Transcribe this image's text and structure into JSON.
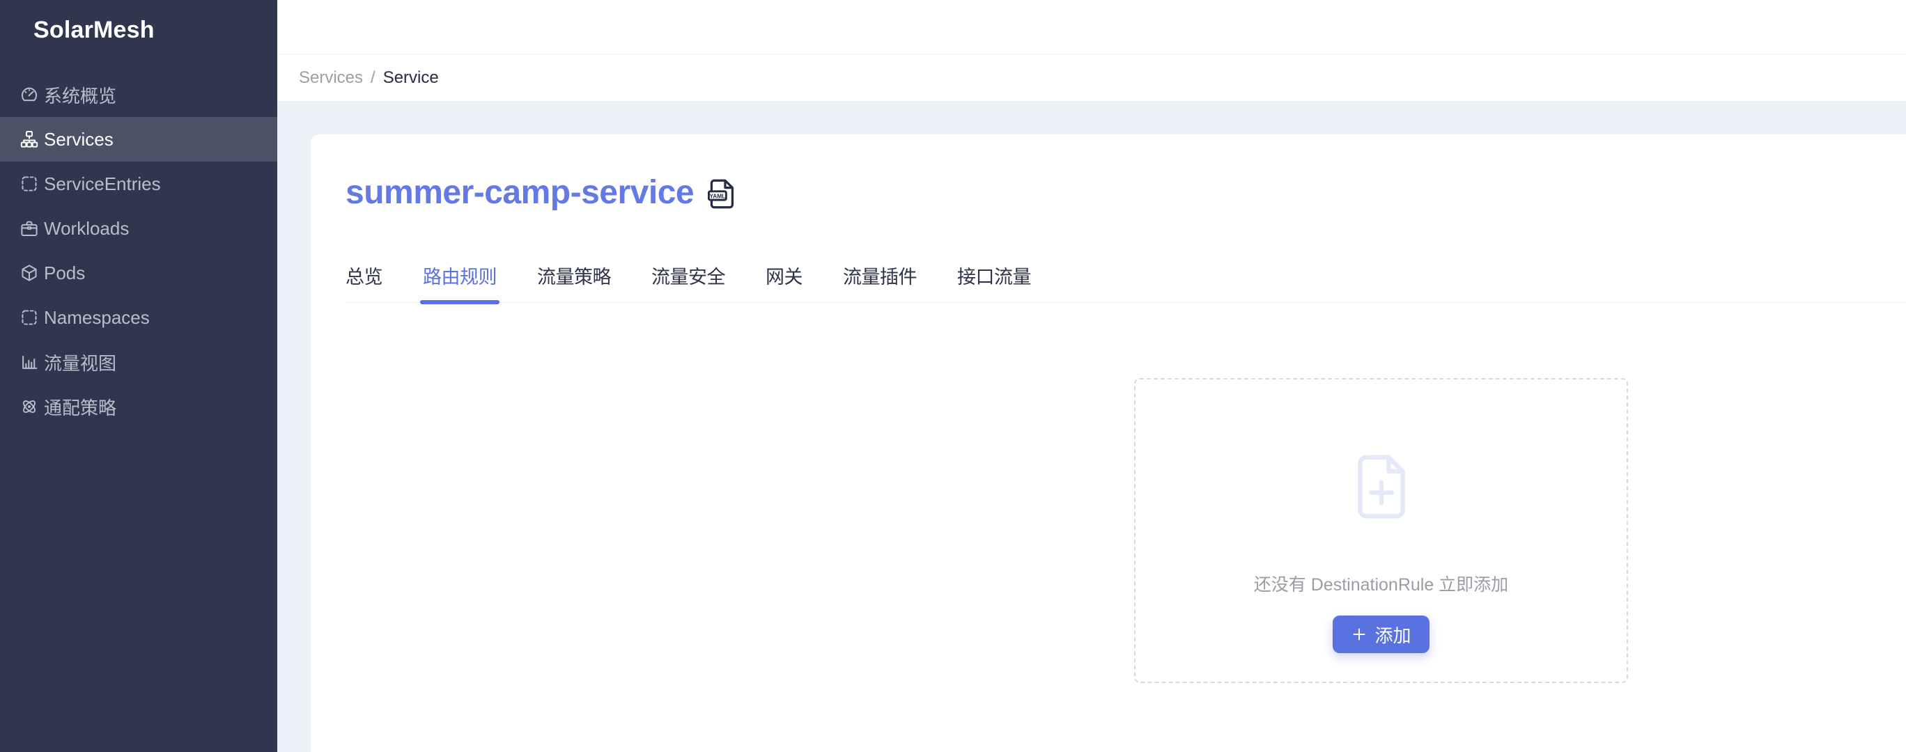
{
  "app": {
    "name": "SolarMesh"
  },
  "sidebar": {
    "logo": "SolarMesh",
    "items": [
      {
        "label": "系统概览",
        "icon": "gauge-icon",
        "active": false
      },
      {
        "label": "Services",
        "icon": "sitemap-icon",
        "active": true
      },
      {
        "label": "ServiceEntries",
        "icon": "dashed-square-icon",
        "active": false
      },
      {
        "label": "Workloads",
        "icon": "briefcase-icon",
        "active": false
      },
      {
        "label": "Pods",
        "icon": "cube-icon",
        "active": false
      },
      {
        "label": "Namespaces",
        "icon": "dashed-square-icon",
        "active": false
      },
      {
        "label": "流量视图",
        "icon": "bar-chart-icon",
        "active": false
      },
      {
        "label": "通配策略",
        "icon": "atom-icon",
        "active": false
      }
    ]
  },
  "breadcrumb": {
    "parent": "Services",
    "separator": "/",
    "current": "Service"
  },
  "service": {
    "title": "summer-camp-service",
    "yaml_badge": "YAML"
  },
  "tabs": [
    {
      "label": "总览",
      "active": false
    },
    {
      "label": "路由规则",
      "active": true
    },
    {
      "label": "流量策略",
      "active": false
    },
    {
      "label": "流量安全",
      "active": false
    },
    {
      "label": "网关",
      "active": false
    },
    {
      "label": "流量插件",
      "active": false
    },
    {
      "label": "接口流量",
      "active": false
    }
  ],
  "empty_state": {
    "icon": "file-plus-icon",
    "message": "还没有 DestinationRule 立即添加",
    "add_button": {
      "icon": "plus-icon",
      "label": "添加"
    }
  },
  "colors": {
    "sidebar_bg": "#30364e",
    "sidebar_active_bg": "#4b5266",
    "accent_blue": "#5b70e4",
    "title_blue": "#6579e5",
    "button_blue": "#5a71e2",
    "content_bg": "#edf0f6",
    "empty_icon": "#e4e9f8"
  }
}
